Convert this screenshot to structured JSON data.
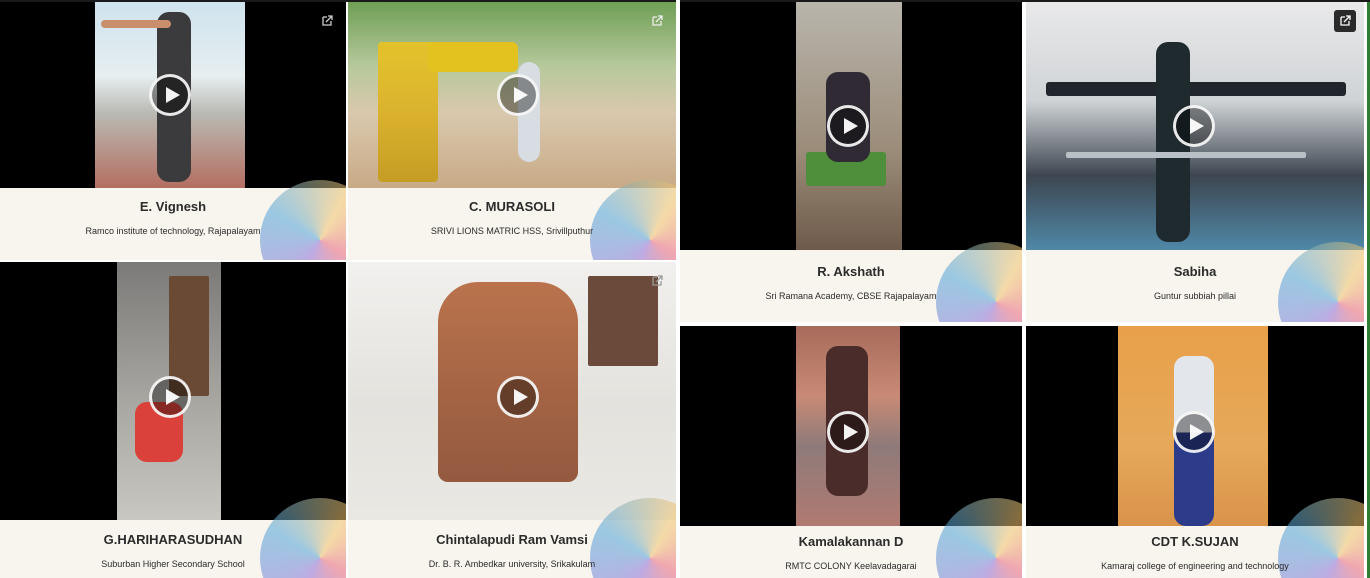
{
  "cards": [
    {
      "name": "E. Vignesh",
      "school": "Ramco institute of technology, Rajapalayam",
      "has_external_icon": true
    },
    {
      "name": "C. MURASOLI",
      "school": "SRIVI LIONS MATRIC HSS, Srivillputhur",
      "has_external_icon": true
    },
    {
      "name": "G.HARIHARASUDHAN",
      "school": "Suburban Higher Secondary School",
      "has_external_icon": false
    },
    {
      "name": "Chintalapudi Ram Vamsi",
      "school": "Dr. B. R. Ambedkar university, Srikakulam",
      "has_external_icon": true
    },
    {
      "name": "R. Akshath",
      "school": "Sri Ramana Academy, CBSE Rajapalayam",
      "has_external_icon": false
    },
    {
      "name": "Sabiha",
      "school": "Guntur subbiah pillai",
      "has_external_icon": true
    },
    {
      "name": "Kamalakannan D",
      "school": "RMTC COLONY Keelavadagarai",
      "has_external_icon": false
    },
    {
      "name": "CDT K.SUJAN",
      "school": "Kamaraj college of engineering and technology",
      "has_external_icon": false
    }
  ],
  "icons": {
    "play": "play-icon",
    "external": "external-link-icon"
  },
  "colors": {
    "text": "#2b2b2b",
    "letterbox": "#000000",
    "card_bg": "#f8f5ee",
    "edge": "#2e7d32"
  }
}
